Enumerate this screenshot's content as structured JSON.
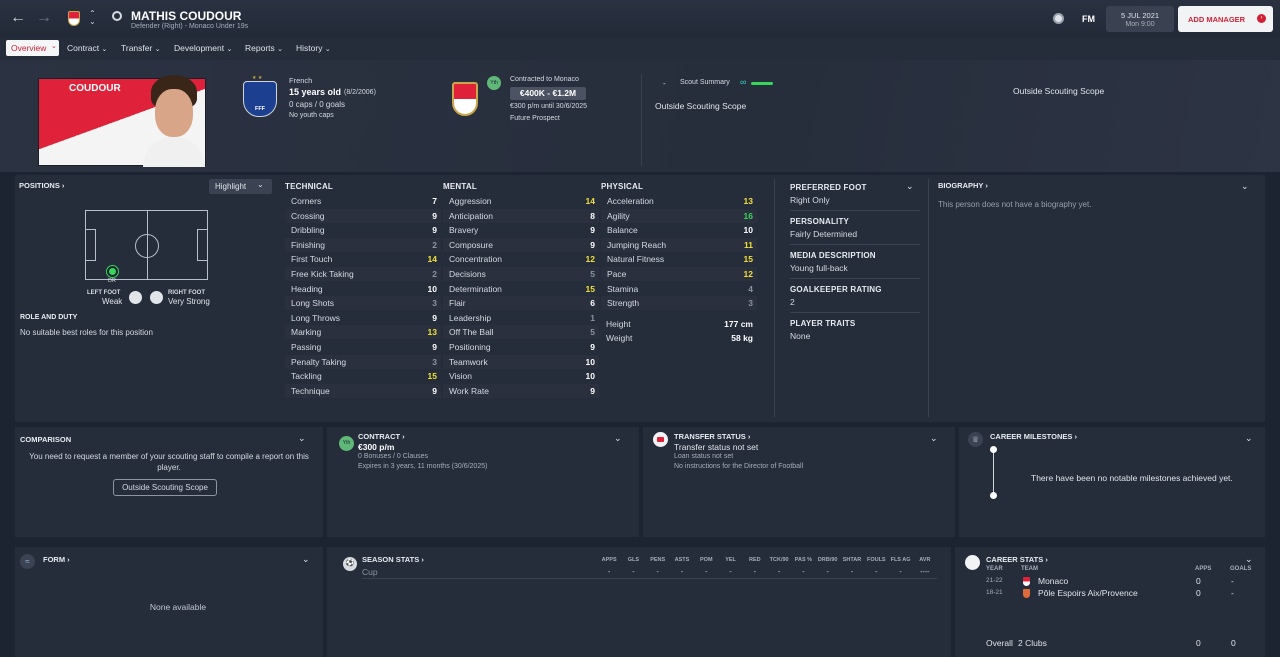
{
  "header": {
    "name": "MATHIS COUDOUR",
    "subtitle": "Defender (Right) - Monaco Under 19s",
    "date": "5 JUL 2021",
    "time": "Mon 9:00",
    "fm": "FM",
    "add_manager": "ADD MANAGER"
  },
  "tabs": [
    "Overview",
    "Contract",
    "Transfer",
    "Development",
    "Reports",
    "History"
  ],
  "profile": {
    "shirt_name": "COUDOUR",
    "nationality": "French",
    "age": "15 years old",
    "dob": "(8/2/2006)",
    "caps": "0 caps / 0 goals",
    "youth_caps": "No youth caps",
    "contract_to": "Contracted to Monaco",
    "value": "€400K - €1.2M",
    "wage": "€300 p/m until 30/6/2025",
    "prospect": "Future Prospect",
    "yth_badge": "Yth",
    "scout_dash": "-",
    "scout_summary": "Scout Summary",
    "scope_1": "Outside Scouting Scope",
    "scope_2": "Outside Scouting Scope"
  },
  "positions": {
    "title": "POSITIONS",
    "highlight": "Highlight",
    "pos_label": "DR",
    "left_foot_label": "LEFT FOOT",
    "left_foot_value": "Weak",
    "right_foot_label": "RIGHT FOOT",
    "right_foot_value": "Very Strong",
    "role_title": "ROLE AND DUTY",
    "role_text": "No suitable best roles for this position"
  },
  "technical": {
    "title": "TECHNICAL",
    "items": [
      [
        "Corners",
        "7"
      ],
      [
        "Crossing",
        "9"
      ],
      [
        "Dribbling",
        "9"
      ],
      [
        "Finishing",
        "2"
      ],
      [
        "First Touch",
        "14"
      ],
      [
        "Free Kick Taking",
        "2"
      ],
      [
        "Heading",
        "10"
      ],
      [
        "Long Shots",
        "3"
      ],
      [
        "Long Throws",
        "9"
      ],
      [
        "Marking",
        "13"
      ],
      [
        "Passing",
        "9"
      ],
      [
        "Penalty Taking",
        "3"
      ],
      [
        "Tackling",
        "15"
      ],
      [
        "Technique",
        "9"
      ]
    ]
  },
  "mental": {
    "title": "MENTAL",
    "items": [
      [
        "Aggression",
        "14"
      ],
      [
        "Anticipation",
        "8"
      ],
      [
        "Bravery",
        "9"
      ],
      [
        "Composure",
        "9"
      ],
      [
        "Concentration",
        "12"
      ],
      [
        "Decisions",
        "5"
      ],
      [
        "Determination",
        "15"
      ],
      [
        "Flair",
        "6"
      ],
      [
        "Leadership",
        "1"
      ],
      [
        "Off The Ball",
        "5"
      ],
      [
        "Positioning",
        "9"
      ],
      [
        "Teamwork",
        "10"
      ],
      [
        "Vision",
        "10"
      ],
      [
        "Work Rate",
        "9"
      ]
    ]
  },
  "physical": {
    "title": "PHYSICAL",
    "items": [
      [
        "Acceleration",
        "13"
      ],
      [
        "Agility",
        "16"
      ],
      [
        "Balance",
        "10"
      ],
      [
        "Jumping Reach",
        "11"
      ],
      [
        "Natural Fitness",
        "15"
      ],
      [
        "Pace",
        "12"
      ],
      [
        "Stamina",
        "4"
      ],
      [
        "Strength",
        "3"
      ]
    ],
    "height_label": "Height",
    "height": "177 cm",
    "weight_label": "Weight",
    "weight": "58 kg"
  },
  "info": {
    "pref_foot_t": "PREFERRED FOOT",
    "pref_foot": "Right Only",
    "personality_t": "PERSONALITY",
    "personality": "Fairly Determined",
    "media_t": "MEDIA DESCRIPTION",
    "media": "Young full-back",
    "gk_t": "GOALKEEPER RATING",
    "gk": "2",
    "traits_t": "PLAYER TRAITS",
    "traits": "None"
  },
  "bio": {
    "title": "BIOGRAPHY",
    "text": "This person does not have a biography yet."
  },
  "comparison": {
    "title": "COMPARISON",
    "text": "You need to request a member of your scouting staff to compile a report on this player.",
    "button": "Outside Scouting Scope"
  },
  "contract": {
    "title": "CONTRACT",
    "wage": "€300 p/m",
    "bonuses": "0 Bonuses / 0 Clauses",
    "expires": "Expires in 3 years, 11 months (30/6/2025)"
  },
  "transfer": {
    "title": "TRANSFER STATUS",
    "status": "Transfer status not set",
    "loan": "Loan status not set",
    "instructions": "No instructions for the Director of Football"
  },
  "milestones": {
    "title": "CAREER MILESTONES",
    "text": "There have been no notable milestones achieved yet."
  },
  "form": {
    "title": "FORM",
    "text": "None available"
  },
  "season": {
    "title": "SEASON STATS",
    "cols": [
      "APPS",
      "GLS",
      "PENS",
      "ASTS",
      "POM",
      "YEL",
      "RED",
      "TCK/90",
      "PAS %",
      "DRB/90",
      "SHTAR",
      "FOULS",
      "FLS AG",
      "AVR"
    ],
    "row_label": "Cup",
    "row_vals": [
      "-",
      "-",
      "-",
      "-",
      "-",
      "-",
      "-",
      "-",
      "-",
      "-",
      "-",
      "-",
      "-",
      "----"
    ]
  },
  "career": {
    "title": "CAREER STATS",
    "year_h": "YEAR",
    "team_h": "TEAM",
    "apps_h": "APPS",
    "goals_h": "GOALS",
    "rows": [
      [
        "21-22",
        "Monaco",
        "0",
        "-"
      ],
      [
        "18-21",
        "Pôle Espoirs Aix/Provence",
        "0",
        "-"
      ]
    ],
    "overall": "Overall",
    "clubs": "2 Clubs",
    "overall_apps": "0",
    "overall_goals": "0"
  },
  "colors": {
    "highlight_yellow": "#f2e03a",
    "highlight_green": "#37d65a",
    "accent_red": "#e0213a"
  }
}
